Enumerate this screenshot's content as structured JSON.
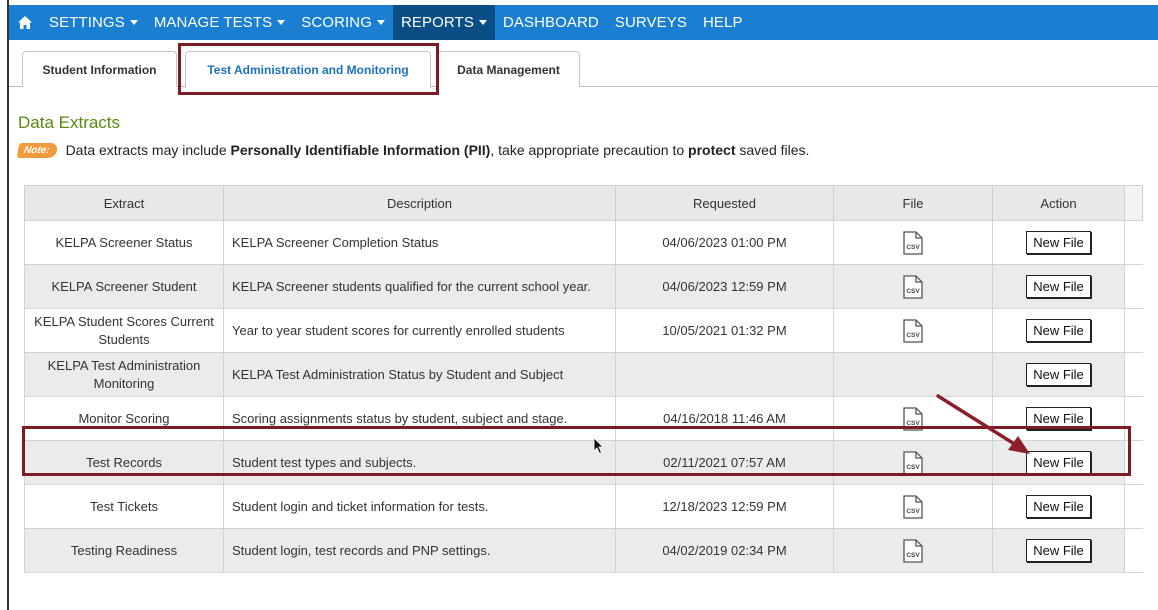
{
  "nav": {
    "items": [
      {
        "label": "SETTINGS",
        "dropdown": true
      },
      {
        "label": "MANAGE TESTS",
        "dropdown": true
      },
      {
        "label": "SCORING",
        "dropdown": true
      },
      {
        "label": "REPORTS",
        "dropdown": true,
        "active": true
      },
      {
        "label": "DASHBOARD",
        "dropdown": false
      },
      {
        "label": "SURVEYS",
        "dropdown": false
      },
      {
        "label": "HELP",
        "dropdown": false
      }
    ]
  },
  "tabs": [
    {
      "label": "Student Information"
    },
    {
      "label": "Test Administration and Monitoring",
      "active": true
    },
    {
      "label": "Data Management"
    }
  ],
  "section": {
    "title": "Data Extracts",
    "note_badge": "Note:",
    "note_part1": "Data extracts may include ",
    "note_bold1": "Personally Identifiable Information (PII)",
    "note_part2": ", take appropriate precaution to ",
    "note_bold2": "protect",
    "note_part3": " saved files."
  },
  "table": {
    "columns": [
      "Extract",
      "Description",
      "Requested",
      "File",
      "Action"
    ],
    "rows": [
      {
        "extract": "KELPA Screener Status",
        "description": "KELPA Screener Completion Status",
        "requested": "04/06/2023 01:00 PM",
        "file": "csv",
        "action": "New File"
      },
      {
        "extract": "KELPA Screener Student",
        "description": "KELPA Screener students qualified for the current school year.",
        "requested": "04/06/2023 12:59 PM",
        "file": "csv",
        "action": "New File"
      },
      {
        "extract": "KELPA Student Scores Current Students",
        "description": "Year to year student scores for currently enrolled students",
        "requested": "10/05/2021 01:32 PM",
        "file": "csv",
        "action": "New File"
      },
      {
        "extract": "KELPA Test Administration Monitoring",
        "description": "KELPA Test Administration Status by Student and Subject",
        "requested": "",
        "file": "",
        "action": "New File"
      },
      {
        "extract": "Monitor Scoring",
        "description": "Scoring assignments status by student, subject and stage.",
        "requested": "04/16/2018 11:46 AM",
        "file": "csv",
        "action": "New File"
      },
      {
        "extract": "Test Records",
        "description": "Student test types and subjects.",
        "requested": "02/11/2021 07:57 AM",
        "file": "csv",
        "action": "New File"
      },
      {
        "extract": "Test Tickets",
        "description": "Student login and ticket information for tests.",
        "requested": "12/18/2023 12:59 PM",
        "file": "csv",
        "action": "New File"
      },
      {
        "extract": "Testing Readiness",
        "description": "Student login, test records and PNP settings.",
        "requested": "04/02/2019 02:34 PM",
        "file": "csv",
        "action": "New File"
      }
    ]
  },
  "colors": {
    "nav_bg": "#1a7fd0",
    "nav_active": "#0b4e86",
    "section_title": "#5a8a0e",
    "highlight": "#7d1b22",
    "note_badge": "#f39a3a"
  }
}
